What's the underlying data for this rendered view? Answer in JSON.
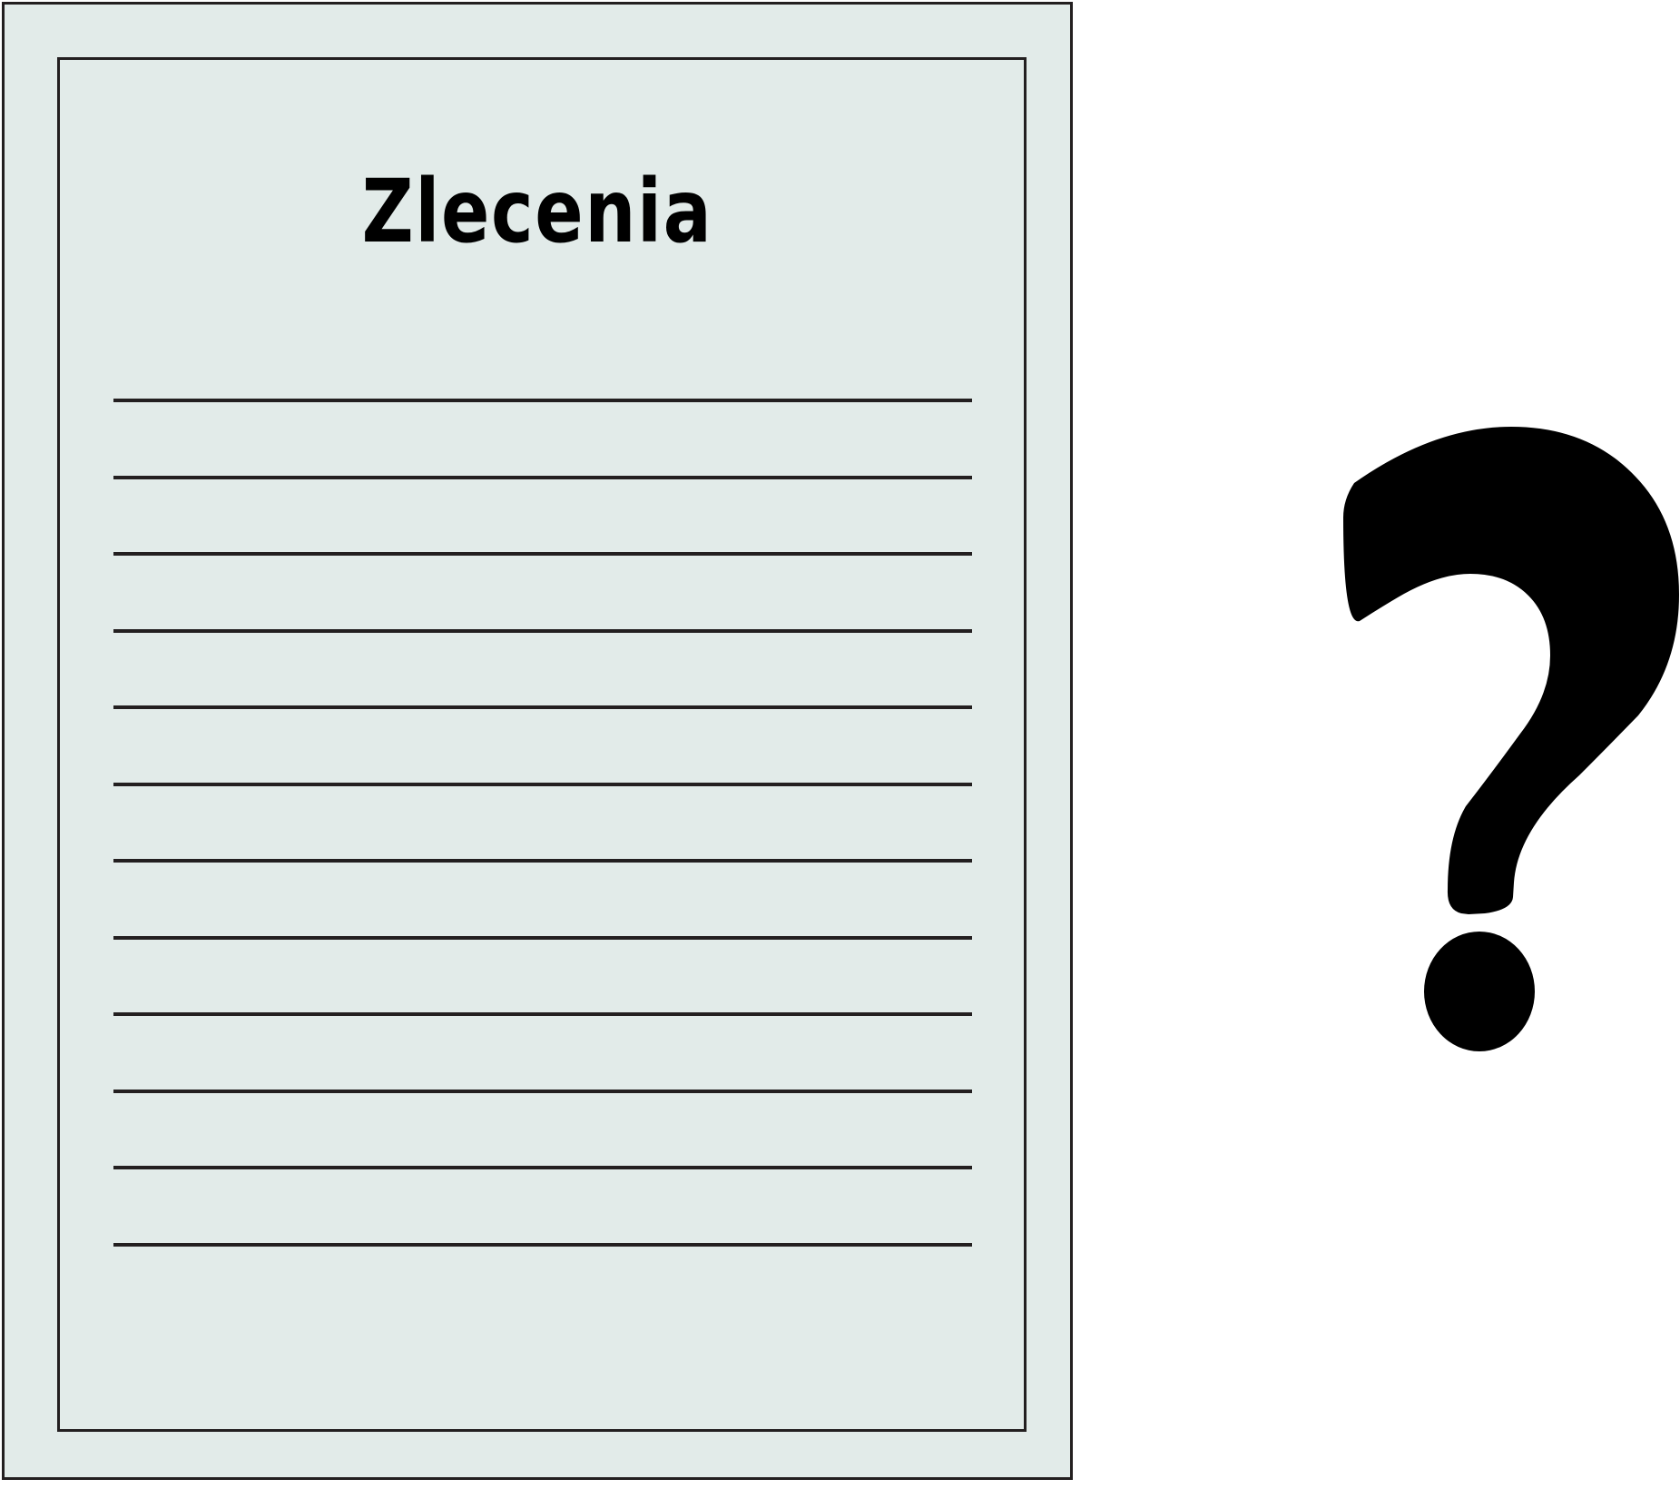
{
  "document": {
    "title": "Zlecenia",
    "rule_count": 12,
    "paper_color": "#e2ebe9",
    "ink_color": "#231f20"
  },
  "icons": {
    "document": "document-icon",
    "question": "question-mark-icon"
  }
}
